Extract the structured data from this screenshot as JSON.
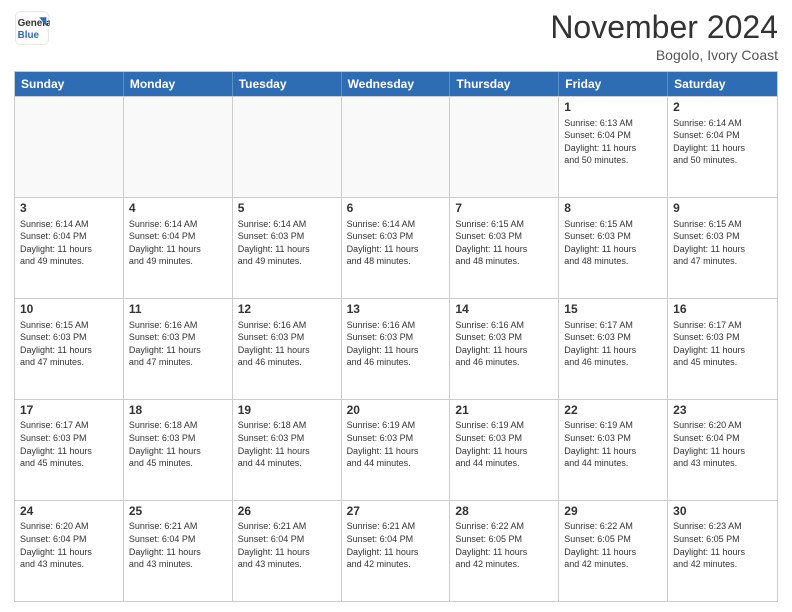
{
  "header": {
    "logo_line1": "General",
    "logo_line2": "Blue",
    "month_title": "November 2024",
    "location": "Bogolo, Ivory Coast"
  },
  "days_of_week": [
    "Sunday",
    "Monday",
    "Tuesday",
    "Wednesday",
    "Thursday",
    "Friday",
    "Saturday"
  ],
  "weeks": [
    [
      {
        "day": "",
        "info": "",
        "empty": true
      },
      {
        "day": "",
        "info": "",
        "empty": true
      },
      {
        "day": "",
        "info": "",
        "empty": true
      },
      {
        "day": "",
        "info": "",
        "empty": true
      },
      {
        "day": "",
        "info": "",
        "empty": true
      },
      {
        "day": "1",
        "info": "Sunrise: 6:13 AM\nSunset: 6:04 PM\nDaylight: 11 hours\nand 50 minutes."
      },
      {
        "day": "2",
        "info": "Sunrise: 6:14 AM\nSunset: 6:04 PM\nDaylight: 11 hours\nand 50 minutes."
      }
    ],
    [
      {
        "day": "3",
        "info": "Sunrise: 6:14 AM\nSunset: 6:04 PM\nDaylight: 11 hours\nand 49 minutes."
      },
      {
        "day": "4",
        "info": "Sunrise: 6:14 AM\nSunset: 6:04 PM\nDaylight: 11 hours\nand 49 minutes."
      },
      {
        "day": "5",
        "info": "Sunrise: 6:14 AM\nSunset: 6:03 PM\nDaylight: 11 hours\nand 49 minutes."
      },
      {
        "day": "6",
        "info": "Sunrise: 6:14 AM\nSunset: 6:03 PM\nDaylight: 11 hours\nand 48 minutes."
      },
      {
        "day": "7",
        "info": "Sunrise: 6:15 AM\nSunset: 6:03 PM\nDaylight: 11 hours\nand 48 minutes."
      },
      {
        "day": "8",
        "info": "Sunrise: 6:15 AM\nSunset: 6:03 PM\nDaylight: 11 hours\nand 48 minutes."
      },
      {
        "day": "9",
        "info": "Sunrise: 6:15 AM\nSunset: 6:03 PM\nDaylight: 11 hours\nand 47 minutes."
      }
    ],
    [
      {
        "day": "10",
        "info": "Sunrise: 6:15 AM\nSunset: 6:03 PM\nDaylight: 11 hours\nand 47 minutes."
      },
      {
        "day": "11",
        "info": "Sunrise: 6:16 AM\nSunset: 6:03 PM\nDaylight: 11 hours\nand 47 minutes."
      },
      {
        "day": "12",
        "info": "Sunrise: 6:16 AM\nSunset: 6:03 PM\nDaylight: 11 hours\nand 46 minutes."
      },
      {
        "day": "13",
        "info": "Sunrise: 6:16 AM\nSunset: 6:03 PM\nDaylight: 11 hours\nand 46 minutes."
      },
      {
        "day": "14",
        "info": "Sunrise: 6:16 AM\nSunset: 6:03 PM\nDaylight: 11 hours\nand 46 minutes."
      },
      {
        "day": "15",
        "info": "Sunrise: 6:17 AM\nSunset: 6:03 PM\nDaylight: 11 hours\nand 46 minutes."
      },
      {
        "day": "16",
        "info": "Sunrise: 6:17 AM\nSunset: 6:03 PM\nDaylight: 11 hours\nand 45 minutes."
      }
    ],
    [
      {
        "day": "17",
        "info": "Sunrise: 6:17 AM\nSunset: 6:03 PM\nDaylight: 11 hours\nand 45 minutes."
      },
      {
        "day": "18",
        "info": "Sunrise: 6:18 AM\nSunset: 6:03 PM\nDaylight: 11 hours\nand 45 minutes."
      },
      {
        "day": "19",
        "info": "Sunrise: 6:18 AM\nSunset: 6:03 PM\nDaylight: 11 hours\nand 44 minutes."
      },
      {
        "day": "20",
        "info": "Sunrise: 6:19 AM\nSunset: 6:03 PM\nDaylight: 11 hours\nand 44 minutes."
      },
      {
        "day": "21",
        "info": "Sunrise: 6:19 AM\nSunset: 6:03 PM\nDaylight: 11 hours\nand 44 minutes."
      },
      {
        "day": "22",
        "info": "Sunrise: 6:19 AM\nSunset: 6:03 PM\nDaylight: 11 hours\nand 44 minutes."
      },
      {
        "day": "23",
        "info": "Sunrise: 6:20 AM\nSunset: 6:04 PM\nDaylight: 11 hours\nand 43 minutes."
      }
    ],
    [
      {
        "day": "24",
        "info": "Sunrise: 6:20 AM\nSunset: 6:04 PM\nDaylight: 11 hours\nand 43 minutes."
      },
      {
        "day": "25",
        "info": "Sunrise: 6:21 AM\nSunset: 6:04 PM\nDaylight: 11 hours\nand 43 minutes."
      },
      {
        "day": "26",
        "info": "Sunrise: 6:21 AM\nSunset: 6:04 PM\nDaylight: 11 hours\nand 43 minutes."
      },
      {
        "day": "27",
        "info": "Sunrise: 6:21 AM\nSunset: 6:04 PM\nDaylight: 11 hours\nand 42 minutes."
      },
      {
        "day": "28",
        "info": "Sunrise: 6:22 AM\nSunset: 6:05 PM\nDaylight: 11 hours\nand 42 minutes."
      },
      {
        "day": "29",
        "info": "Sunrise: 6:22 AM\nSunset: 6:05 PM\nDaylight: 11 hours\nand 42 minutes."
      },
      {
        "day": "30",
        "info": "Sunrise: 6:23 AM\nSunset: 6:05 PM\nDaylight: 11 hours\nand 42 minutes."
      }
    ]
  ]
}
